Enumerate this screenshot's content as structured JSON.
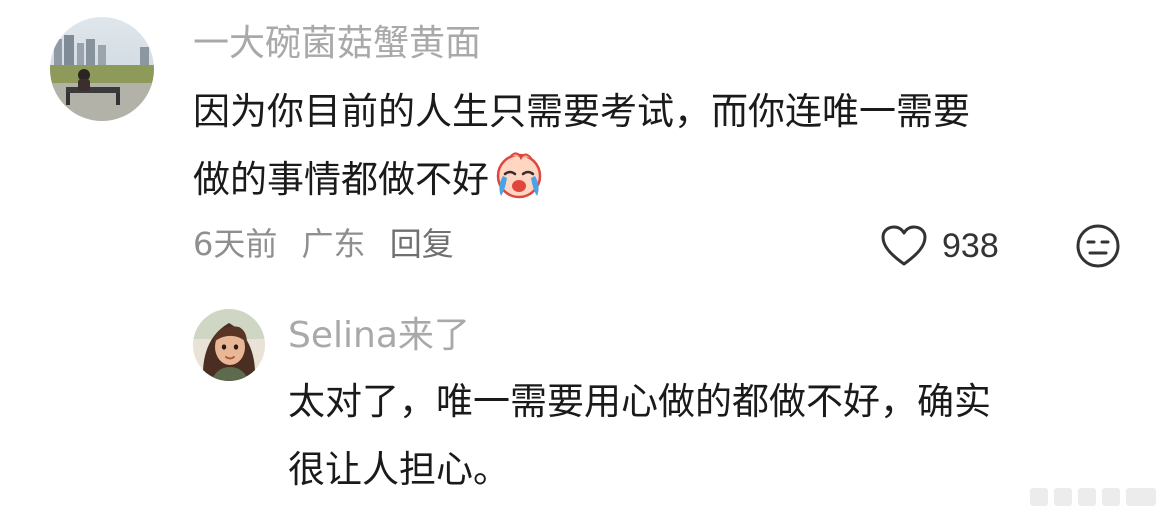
{
  "comment": {
    "username": "一大碗菌菇蟹黄面",
    "text_lines": [
      "因为你目前的人生只需要考试，而你连唯一需要",
      "做的事情都做不好"
    ],
    "emoji": "crying-face-emoji",
    "meta": {
      "time": "6天前",
      "location": "广东",
      "reply_label": "回复"
    },
    "likes": "938",
    "like_icon": "heart-icon",
    "dislike_icon": "meh-face-icon"
  },
  "reply": {
    "username": "Selina来了",
    "text_lines": [
      "太对了，唯一需要用心做的都做不好，确实",
      "很让人担心。"
    ]
  },
  "colors": {
    "username": "#a9a9a9",
    "text": "#1a1a1a",
    "meta": "#8f8f8f"
  }
}
